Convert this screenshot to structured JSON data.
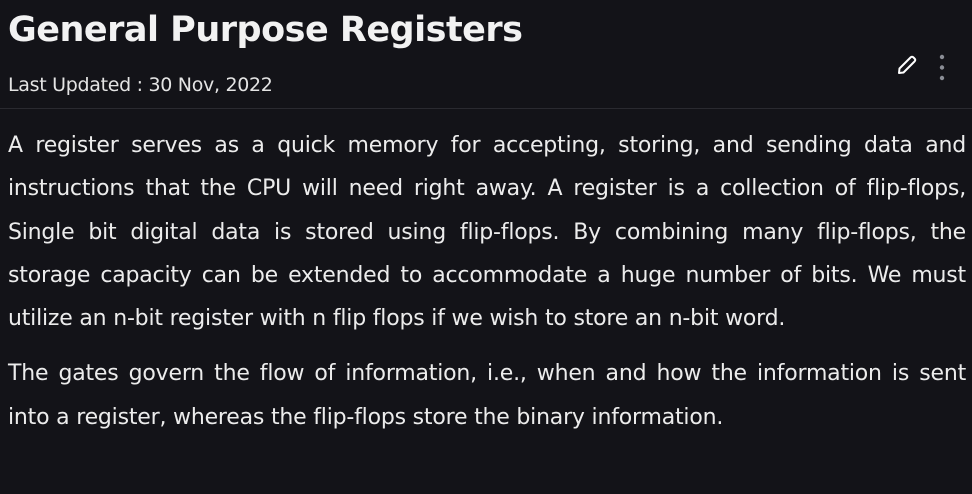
{
  "article": {
    "title": "General Purpose Registers",
    "last_updated": "Last Updated : 30 Nov, 2022",
    "paragraphs": [
      "A register serves as a quick memory for accepting, storing, and sending data and instructions that the CPU will need right away. A register is a collection of flip-flops, Single bit digital data is stored using flip-flops. By combining many flip-flops, the storage capacity can be extended to accommodate a huge number of bits. We must utilize an n-bit register with n flip flops if we wish to store an n-bit word.",
      "The gates govern the flow of information, i.e., when and how the information is sent into a register, whereas the flip-flops store the binary information."
    ]
  },
  "icons": {
    "edit": "pencil-icon",
    "more": "more-vertical-icon"
  }
}
